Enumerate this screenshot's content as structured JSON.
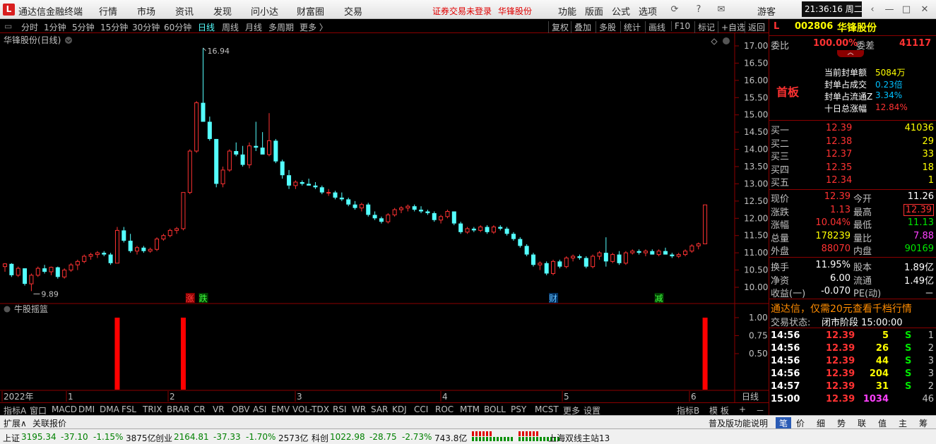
{
  "app": {
    "title": "通达信金融终端",
    "menu": [
      "行情",
      "市场",
      "资讯",
      "发现",
      "问小达",
      "财富圈",
      "交易"
    ],
    "notice": "证券交易未登录",
    "stock_link": "华锋股份",
    "menu_right": [
      "功能",
      "版面",
      "公式",
      "选项"
    ],
    "user": "游客",
    "clock": "21:36:16 周二"
  },
  "toolbar": {
    "periods": [
      "分时",
      "1分钟",
      "5分钟",
      "15分钟",
      "30分钟",
      "60分钟",
      "日线",
      "周线",
      "月线",
      "多周期",
      "更多 〉"
    ],
    "active_period": "日线",
    "tools": [
      "复权",
      "叠加",
      "多股",
      "统计",
      "画线",
      "F10",
      "标记",
      "+自选",
      "返回"
    ]
  },
  "chart": {
    "label": "华锋股份(日线)",
    "price_ticks": [
      "17.00",
      "16.50",
      "16.00",
      "15.50",
      "15.00",
      "14.50",
      "14.00",
      "13.50",
      "13.00",
      "12.50",
      "12.00",
      "11.50",
      "11.00",
      "10.50",
      "10.00"
    ],
    "high_label": "16.94",
    "low_label": "9.89",
    "markers": [
      "涨",
      "跌",
      "财",
      "减"
    ],
    "x_labels": [
      "2022年",
      "1",
      "2",
      "3",
      "4",
      "5",
      "6"
    ],
    "period_tag": "日线",
    "colors": {
      "up": "#ff3232",
      "down": "#54ffff",
      "grid": "#8b0000"
    }
  },
  "indicator": {
    "name": "牛股摇篮",
    "ticks": [
      "1.00",
      "0.75",
      "0.50"
    ],
    "signal_values": [
      1,
      1,
      1
    ]
  },
  "chart_data": {
    "type": "candlestick",
    "y_range": [
      9.8,
      17.2
    ],
    "candles": [
      [
        10.6,
        10.7,
        10.45,
        10.68
      ],
      [
        10.68,
        10.7,
        10.3,
        10.35
      ],
      [
        10.35,
        10.6,
        10.3,
        10.55
      ],
      [
        10.55,
        10.55,
        10.05,
        10.1
      ],
      [
        10.1,
        10.4,
        9.89,
        10.35
      ],
      [
        10.35,
        10.6,
        10.3,
        10.55
      ],
      [
        10.55,
        10.65,
        10.4,
        10.45
      ],
      [
        10.45,
        10.6,
        10.35,
        10.58
      ],
      [
        10.58,
        10.6,
        10.25,
        10.3
      ],
      [
        10.3,
        10.55,
        10.25,
        10.5
      ],
      [
        10.5,
        10.7,
        10.45,
        10.65
      ],
      [
        10.65,
        10.8,
        10.5,
        10.75
      ],
      [
        10.75,
        10.95,
        10.7,
        10.9
      ],
      [
        10.9,
        11.0,
        10.8,
        10.95
      ],
      [
        10.95,
        11.05,
        10.85,
        11.0
      ],
      [
        11.0,
        11.05,
        10.9,
        10.95
      ],
      [
        10.95,
        11.0,
        10.65,
        10.7
      ],
      [
        10.7,
        11.75,
        10.7,
        11.65
      ],
      [
        11.65,
        11.75,
        11.3,
        11.35
      ],
      [
        11.35,
        11.55,
        11.0,
        11.05
      ],
      [
        11.05,
        11.2,
        10.95,
        11.15
      ],
      [
        11.15,
        11.2,
        11.0,
        11.05
      ],
      [
        11.05,
        11.15,
        11.0,
        11.1
      ],
      [
        11.1,
        11.45,
        11.05,
        11.4
      ],
      [
        11.4,
        11.55,
        11.35,
        11.5
      ],
      [
        11.5,
        11.7,
        11.45,
        11.65
      ],
      [
        11.65,
        11.75,
        11.55,
        11.7
      ],
      [
        11.7,
        12.75,
        11.65,
        12.75
      ],
      [
        12.75,
        14.0,
        12.7,
        13.95
      ],
      [
        13.95,
        15.4,
        13.9,
        15.35
      ],
      [
        15.35,
        16.94,
        14.8,
        14.8
      ],
      [
        14.8,
        14.95,
        14.25,
        14.3
      ],
      [
        14.3,
        14.3,
        12.9,
        13.0
      ],
      [
        13.0,
        13.5,
        12.9,
        13.4
      ],
      [
        13.4,
        14.0,
        13.35,
        13.95
      ],
      [
        13.95,
        14.2,
        13.8,
        13.85
      ],
      [
        13.85,
        14.1,
        13.5,
        13.55
      ],
      [
        13.55,
        14.2,
        13.45,
        14.1
      ],
      [
        14.1,
        14.8,
        13.95,
        14.05
      ],
      [
        14.05,
        14.5,
        13.9,
        13.85
      ],
      [
        13.85,
        15.05,
        13.8,
        14.25
      ],
      [
        14.25,
        14.3,
        13.6,
        13.65
      ],
      [
        13.65,
        13.7,
        13.15,
        13.25
      ],
      [
        13.25,
        13.4,
        12.85,
        12.95
      ],
      [
        12.95,
        13.1,
        12.85,
        13.05
      ],
      [
        13.05,
        13.1,
        12.95,
        13.0
      ],
      [
        13.0,
        13.15,
        12.95,
        12.95
      ],
      [
        12.95,
        13.05,
        12.85,
        12.9
      ],
      [
        12.9,
        12.95,
        12.7,
        12.75
      ],
      [
        12.75,
        12.85,
        12.65,
        12.75
      ],
      [
        12.75,
        12.8,
        12.55,
        12.6
      ],
      [
        12.6,
        12.75,
        12.5,
        12.55
      ],
      [
        12.55,
        12.6,
        12.35,
        12.4
      ],
      [
        12.4,
        12.5,
        12.25,
        12.3
      ],
      [
        12.3,
        12.45,
        12.2,
        12.4
      ],
      [
        12.4,
        12.45,
        12.05,
        12.1
      ],
      [
        12.1,
        12.2,
        11.95,
        12.0
      ],
      [
        12.0,
        12.05,
        11.85,
        11.9
      ],
      [
        11.9,
        12.15,
        11.85,
        12.1
      ],
      [
        12.1,
        12.3,
        12.05,
        12.25
      ],
      [
        12.25,
        12.35,
        12.15,
        12.3
      ],
      [
        12.3,
        12.4,
        12.2,
        12.35
      ],
      [
        12.35,
        12.4,
        12.2,
        12.25
      ],
      [
        12.25,
        12.35,
        12.15,
        12.2
      ],
      [
        12.2,
        12.25,
        12.1,
        12.15
      ],
      [
        12.15,
        12.2,
        11.9,
        11.95
      ],
      [
        11.95,
        12.1,
        11.85,
        12.05
      ],
      [
        12.05,
        12.25,
        12.0,
        12.2
      ],
      [
        12.2,
        12.2,
        11.8,
        11.85
      ],
      [
        11.85,
        11.9,
        11.55,
        11.6
      ],
      [
        11.6,
        11.75,
        11.55,
        11.7
      ],
      [
        11.7,
        11.75,
        11.6,
        11.65
      ],
      [
        11.65,
        11.8,
        11.6,
        11.75
      ],
      [
        11.75,
        11.8,
        11.55,
        11.6
      ],
      [
        11.6,
        11.8,
        11.55,
        11.75
      ],
      [
        11.75,
        11.8,
        11.65,
        11.7
      ],
      [
        11.7,
        11.75,
        11.5,
        11.55
      ],
      [
        11.55,
        11.6,
        11.35,
        11.4
      ],
      [
        11.4,
        11.45,
        11.15,
        11.2
      ],
      [
        11.2,
        11.25,
        10.9,
        10.95
      ],
      [
        10.95,
        11.0,
        10.6,
        10.65
      ],
      [
        10.65,
        10.75,
        10.5,
        10.7
      ],
      [
        10.7,
        10.75,
        10.35,
        10.4
      ],
      [
        10.4,
        10.8,
        10.35,
        10.75
      ],
      [
        10.75,
        10.8,
        10.55,
        10.6
      ],
      [
        10.6,
        10.9,
        10.55,
        10.85
      ],
      [
        10.85,
        10.95,
        10.75,
        10.9
      ],
      [
        10.9,
        10.95,
        10.8,
        10.85
      ],
      [
        10.85,
        10.9,
        10.55,
        10.6
      ],
      [
        10.6,
        10.95,
        10.55,
        10.9
      ],
      [
        10.9,
        11.05,
        10.8,
        11.0
      ],
      [
        11.0,
        11.45,
        10.6,
        10.75
      ],
      [
        10.75,
        11.0,
        10.7,
        10.95
      ],
      [
        10.95,
        11.05,
        10.65,
        10.7
      ],
      [
        10.7,
        11.05,
        10.65,
        11.0
      ],
      [
        11.0,
        11.1,
        10.95,
        11.05
      ],
      [
        11.05,
        11.1,
        10.95,
        11.0
      ],
      [
        11.0,
        11.1,
        10.9,
        11.05
      ],
      [
        11.05,
        11.1,
        10.95,
        10.95
      ],
      [
        10.95,
        11.1,
        10.9,
        11.05
      ],
      [
        11.05,
        11.15,
        10.95,
        10.95
      ],
      [
        10.95,
        11.0,
        10.85,
        10.9
      ],
      [
        10.9,
        11.0,
        10.85,
        10.95
      ],
      [
        10.95,
        11.1,
        10.9,
        11.05
      ],
      [
        11.05,
        11.25,
        11.0,
        11.2
      ],
      [
        11.2,
        11.3,
        11.1,
        11.26
      ],
      [
        11.26,
        12.39,
        11.26,
        12.39
      ]
    ],
    "signals_at_index": [
      17,
      27,
      106
    ]
  },
  "quote": {
    "marker": "L",
    "code": "002806",
    "name": "华锋股份",
    "weibi_label": "委比",
    "weibi_value": "100.00%",
    "weicha_label": "委差",
    "weicha_value": "41117",
    "tag": "首板",
    "info": [
      {
        "label": "当前封单额",
        "value": "5084万",
        "color": "yel"
      },
      {
        "label": "封单占成交",
        "value": "0.23倍",
        "color": "cyn"
      },
      {
        "label": "封单占流通Z",
        "value": "3.34%",
        "color": "cyn"
      },
      {
        "label": "十日总涨幅",
        "value": "12.84%",
        "color": "red"
      }
    ],
    "bids": [
      {
        "label": "买一",
        "price": "12.39",
        "vol": "41036"
      },
      {
        "label": "买二",
        "price": "12.38",
        "vol": "29"
      },
      {
        "label": "买三",
        "price": "12.37",
        "vol": "33"
      },
      {
        "label": "买四",
        "price": "12.35",
        "vol": "18"
      },
      {
        "label": "买五",
        "price": "12.34",
        "vol": "1"
      }
    ],
    "stats": [
      {
        "l1": "现价",
        "v1": "12.39",
        "c1": "red",
        "l2": "今开",
        "v2": "11.26",
        "c2": "wht"
      },
      {
        "l1": "涨跌",
        "v1": "1.13",
        "c1": "red",
        "l2": "最高",
        "v2": "12.39",
        "c2": "red"
      },
      {
        "l1": "涨幅",
        "v1": "10.04%",
        "c1": "red",
        "l2": "最低",
        "v2": "11.13",
        "c2": "grn"
      },
      {
        "l1": "总量",
        "v1": "178239",
        "c1": "yel",
        "l2": "量比",
        "v2": "7.88",
        "c2": "mag"
      },
      {
        "l1": "外盘",
        "v1": "88070",
        "c1": "red",
        "l2": "内盘",
        "v2": "90169",
        "c2": "grn"
      }
    ],
    "stats2": [
      {
        "l1": "换手",
        "v1": "11.95%",
        "l2": "股本",
        "v2": "1.89亿"
      },
      {
        "l1": "净资",
        "v1": "6.00",
        "l2": "流通",
        "v2": "1.49亿"
      },
      {
        "l1": "收益(一)",
        "v1": "-0.070",
        "l2": "PE(动)",
        "v2": "－"
      }
    ],
    "promo": "通达信，仅需20元查看千档行情",
    "trade_state_label": "交易状态:",
    "trade_state": "闭市阶段 15:00:00",
    "ticks": [
      {
        "time": "14:56",
        "price": "12.39",
        "vol": "5",
        "side": "S",
        "n": "1"
      },
      {
        "time": "14:56",
        "price": "12.39",
        "vol": "26",
        "side": "S",
        "n": "2"
      },
      {
        "time": "14:56",
        "price": "12.39",
        "vol": "44",
        "side": "S",
        "n": "3"
      },
      {
        "time": "14:56",
        "price": "12.39",
        "vol": "204",
        "side": "S",
        "n": "3"
      },
      {
        "time": "14:57",
        "price": "12.39",
        "vol": "31",
        "side": "S",
        "n": "2"
      },
      {
        "time": "15:00",
        "price": "12.39",
        "vol": "1034",
        "side": "",
        "n": "46"
      }
    ]
  },
  "tabs": {
    "left": [
      "指标A",
      "窗口",
      "MACD",
      "DMI",
      "DMA",
      "FSL",
      "TRIX",
      "BRAR",
      "CR",
      "VR",
      "OBV",
      "ASI",
      "EMV",
      "VOL-TDX",
      "RSI",
      "WR",
      "SAR",
      "KDJ",
      "CCI",
      "ROC",
      "MTM",
      "BOLL",
      "PSY",
      "MCST",
      "更多",
      "设置"
    ],
    "right": [
      "指标B",
      "模 板",
      "+",
      "－"
    ]
  },
  "bar2": {
    "left": [
      "扩展∧",
      "关联报价"
    ],
    "help": "普及版功能说明",
    "right_tabs": [
      "笔",
      "价",
      "细",
      "势",
      "联",
      "值",
      "主",
      "筹"
    ]
  },
  "status": {
    "items": [
      {
        "name": "上证",
        "val": "3195.34",
        "chg": "-37.10",
        "pct": "-1.15%",
        "amt": "3875亿"
      },
      {
        "name": "创业",
        "val": "2164.81",
        "chg": "-37.33",
        "pct": "-1.70%",
        "amt": "2573亿"
      },
      {
        "name": "科创",
        "val": "1022.98",
        "chg": "-28.75",
        "pct": "-2.73%",
        "amt": "743.8亿"
      }
    ],
    "server": "上海双线主站13"
  }
}
